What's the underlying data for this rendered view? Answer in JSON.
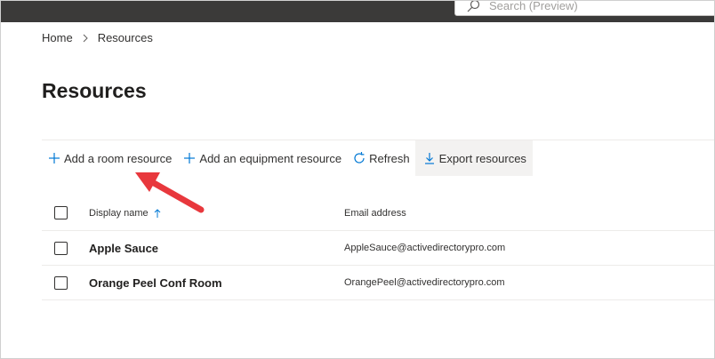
{
  "search": {
    "placeholder": "Search (Preview)",
    "icon": "search-icon"
  },
  "breadcrumb": {
    "home": "Home",
    "current": "Resources"
  },
  "page": {
    "title": "Resources"
  },
  "commands": {
    "add_room": "Add a room resource",
    "add_equipment": "Add an equipment resource",
    "refresh": "Refresh",
    "export": "Export resources"
  },
  "table": {
    "columns": {
      "display_name": "Display name",
      "email": "Email address"
    },
    "rows": [
      {
        "name": "Apple Sauce",
        "email": "AppleSauce@activedirectorypro.com"
      },
      {
        "name": "Orange Peel Conf Room",
        "email": "OrangePeel@activedirectorypro.com"
      }
    ]
  },
  "colors": {
    "topbar": "#3b3a39",
    "accent": "#0078d4",
    "annotation": "#e8383d"
  }
}
